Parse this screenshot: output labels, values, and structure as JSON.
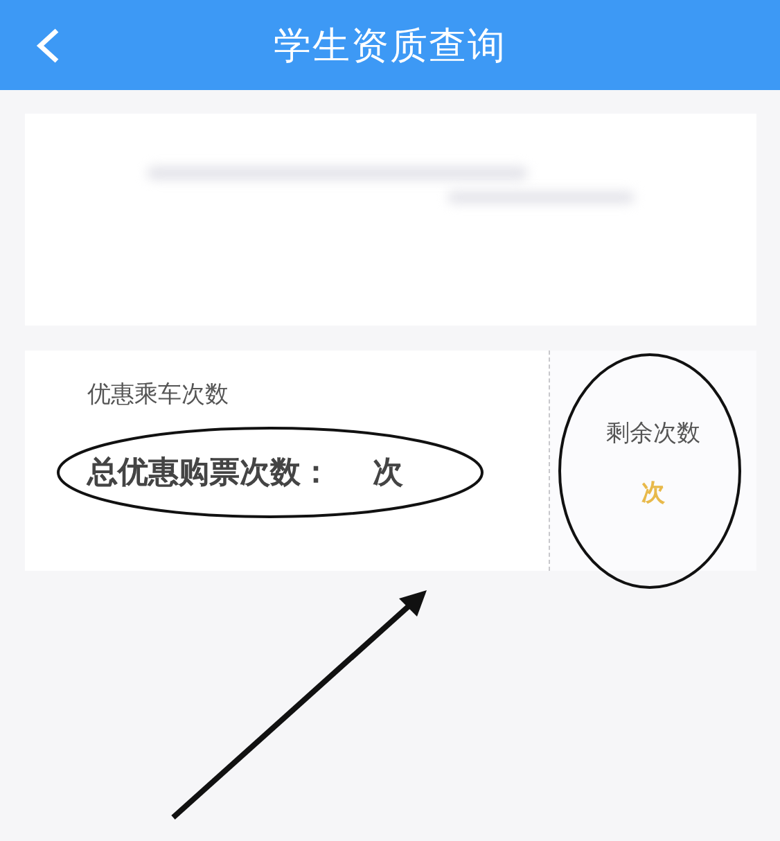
{
  "header": {
    "title": "学生资质查询"
  },
  "ride_card": {
    "section_title": "优惠乘车次数",
    "total_label": "总优惠购票次数：",
    "total_unit": "次",
    "remaining_label": "剩余次数",
    "remaining_unit": "次"
  },
  "annotations": [
    {
      "kind": "ellipse"
    },
    {
      "kind": "ellipse"
    },
    {
      "kind": "arrow"
    }
  ]
}
